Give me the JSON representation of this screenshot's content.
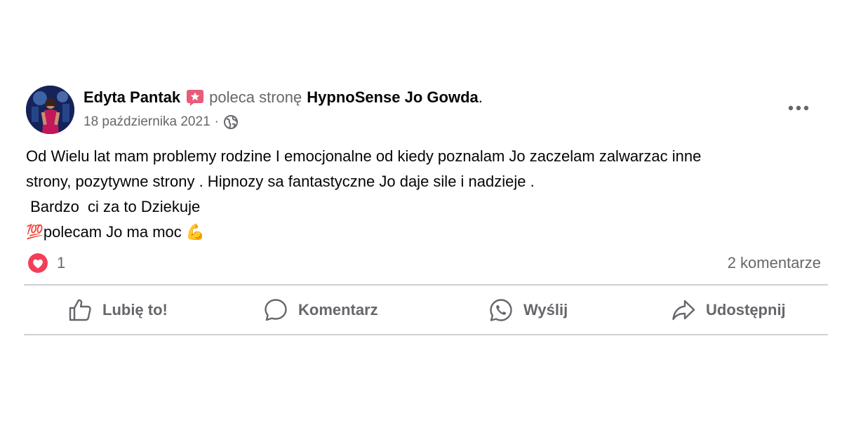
{
  "post": {
    "author": "Edyta Pantak",
    "verb": "poleca stronę",
    "page_name": "HypnoSense Jo Gowda",
    "period": ".",
    "date": "18 października 2021",
    "separator": "·",
    "body_lines": [
      "Od Wielu lat mam problemy rodzine I emocjonalne od kiedy poznalam Jo zaczelam zalwarzac inne",
      "strony, pozytywne strony . Hipnozy sa fantastyczne Jo daje sile i nadzieje .",
      " Bardzo  ci za to Dziekuje",
      "polecam Jo ma moc "
    ],
    "emoji_100": "💯",
    "emoji_muscle": "💪"
  },
  "reactions": {
    "count": "1",
    "comments": "2 komentarze"
  },
  "actions": {
    "like": "Lubię to!",
    "comment": "Komentarz",
    "send": "Wyślij",
    "share": "Udostępnij"
  },
  "icons": {
    "recommend_badge": "recommend-badge-icon",
    "privacy": "globe-icon",
    "more": "more-options-icon",
    "reaction": "love-reaction-icon",
    "like": "thumbs-up-icon",
    "comment": "comment-bubble-icon",
    "send": "whatsapp-icon",
    "share": "share-arrow-icon"
  },
  "colors": {
    "text_primary": "#050505",
    "text_secondary": "#65676b",
    "divider": "#ced0d4",
    "love_red": "#f33e58",
    "recommend_pink": "#e85c7a"
  }
}
